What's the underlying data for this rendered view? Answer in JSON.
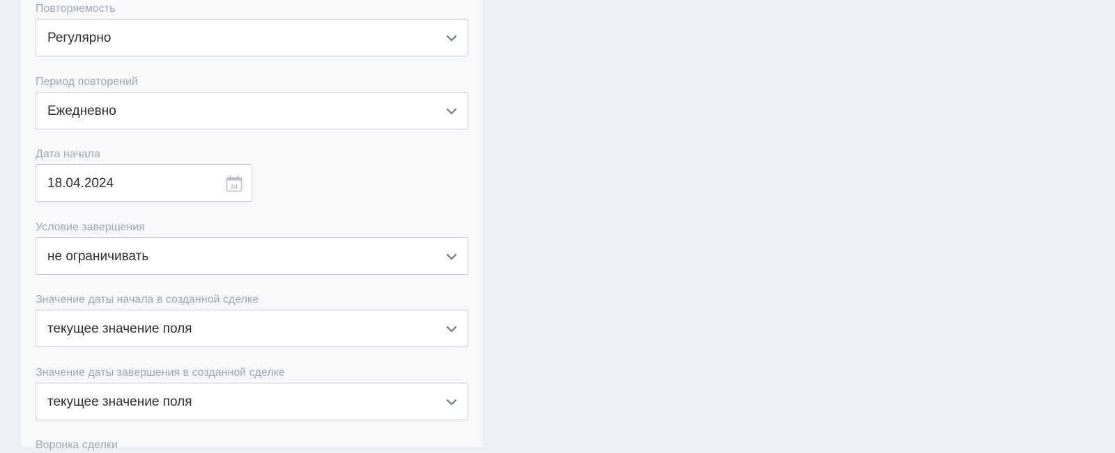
{
  "fields": [
    {
      "label": "Повторяемость",
      "value": "Регулярно",
      "icon": "chevron-down-icon"
    },
    {
      "label": "Период повторений",
      "value": "Ежедневно",
      "icon": "chevron-down-icon"
    },
    {
      "label": "Дата начала",
      "value": "18.04.2024",
      "icon": "calendar-icon",
      "calendar_day": "24"
    },
    {
      "label": "Условие завершения",
      "value": "не ограничивать",
      "icon": "chevron-down-icon"
    },
    {
      "label": "Значение даты начала в созданной сделке",
      "value": "текущее значение поля",
      "icon": "chevron-down-icon"
    },
    {
      "label": "Значение даты завершения в созданной сделке",
      "value": "текущее значение поля",
      "icon": "chevron-down-icon"
    },
    {
      "label": "Воронка сделки"
    }
  ],
  "colors": {
    "page_bg": "#edf1f5",
    "panel_bg": "#f6f8fa",
    "label": "#9fa8b2",
    "value": "#2b2f33",
    "border": "#c4cbd4",
    "icon": "#7b858f"
  }
}
